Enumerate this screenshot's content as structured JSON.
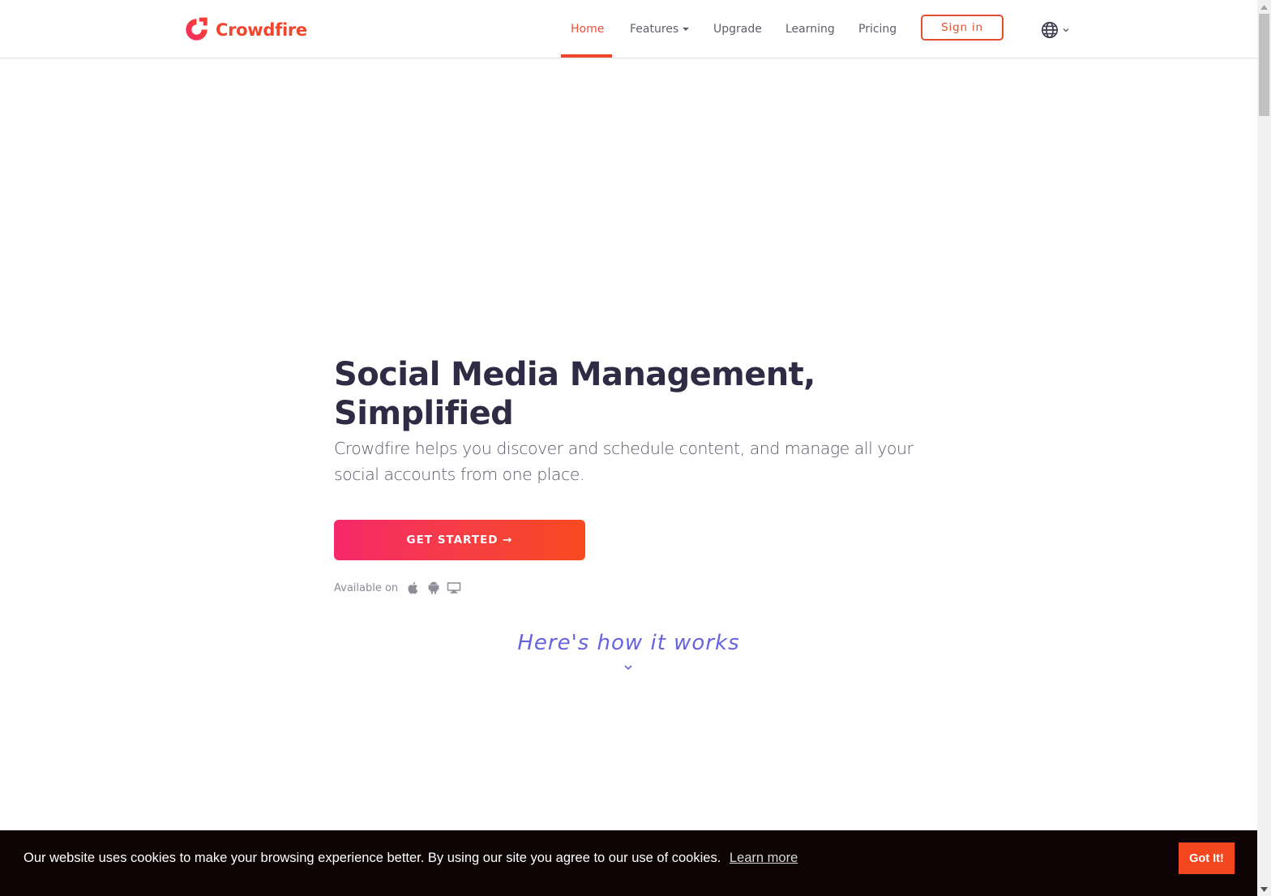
{
  "brand": {
    "name": "Crowdfire",
    "accent_color": "#f2452e"
  },
  "nav": {
    "items": [
      {
        "label": "Home",
        "active": true
      },
      {
        "label": "Features",
        "has_dropdown": true
      },
      {
        "label": "Upgrade"
      },
      {
        "label": "Learning"
      },
      {
        "label": "Pricing"
      }
    ],
    "signin_label": "Sign in",
    "language_icon": "globe-icon"
  },
  "hero": {
    "title_line1": "Social Media Management,",
    "title_line2": "Simplified",
    "subtitle": "Crowdfire helps you discover and schedule content, and manage all your social accounts from one place.",
    "cta_label": "GET STARTED →",
    "cta_gradient": [
      "#f5286a",
      "#f8491f"
    ],
    "available_label": "Available on",
    "platforms": [
      "apple-icon",
      "android-icon",
      "desktop-icon"
    ]
  },
  "how_it_works": {
    "label": "Here's how it works",
    "color": "#6563e0"
  },
  "cookie_banner": {
    "text": "Our website uses cookies to make your browsing experience better. By using our site you agree to our use of cookies.",
    "link_label": "Learn more",
    "button_label": "Got It!",
    "button_color": "#f4461f"
  }
}
